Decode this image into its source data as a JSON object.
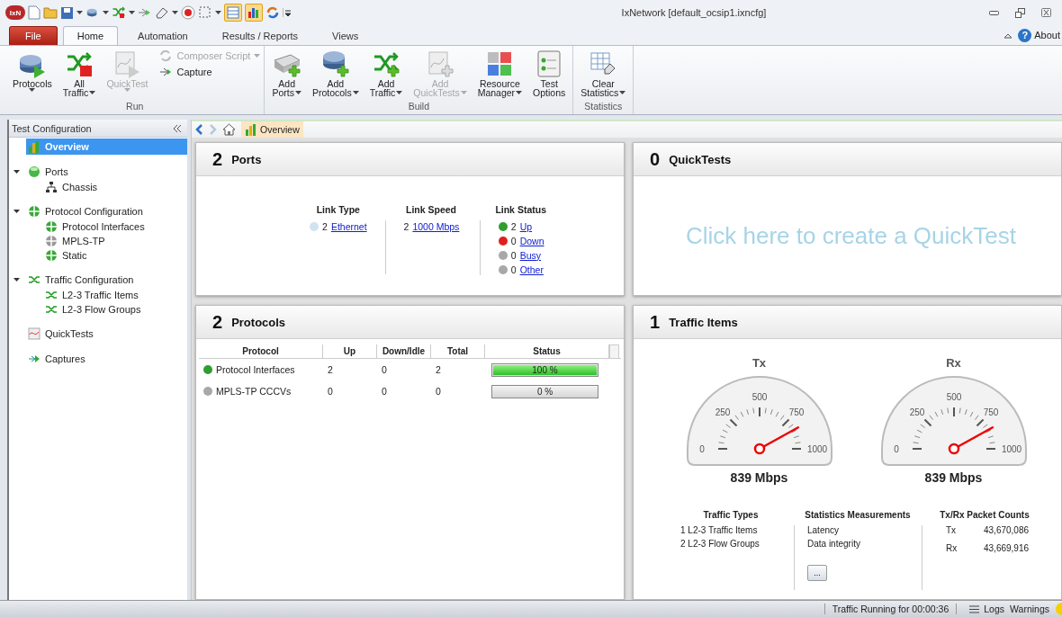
{
  "window": {
    "logo": "IxN",
    "title": "IxNetwork [default_ocsip1.ixncfg]"
  },
  "quick_access_toggles": [
    {
      "selected": true
    },
    {
      "selected": true
    }
  ],
  "file_menu": {
    "label": "File"
  },
  "ribbon_tabs": [
    {
      "label": "Home",
      "selected": true
    },
    {
      "label": "Automation",
      "selected": false
    },
    {
      "label": "Results / Reports",
      "selected": false
    },
    {
      "label": "Views",
      "selected": false
    }
  ],
  "help": {
    "symbol": "?",
    "label": "About"
  },
  "ribbon_groups": [
    {
      "title": "Run",
      "large": [
        {
          "lines": [
            "Protocols"
          ],
          "dropdown": true,
          "disabled": false
        },
        {
          "lines": [
            "All",
            "Traffic"
          ],
          "dropdown": true,
          "disabled": false
        },
        {
          "lines": [
            "QuickTest"
          ],
          "dropdown": true,
          "disabled": true
        }
      ],
      "small": [
        {
          "label": "Composer Script",
          "dropdown": true,
          "disabled": true
        },
        {
          "label": "Capture",
          "dropdown": false,
          "disabled": false
        }
      ]
    },
    {
      "title": "Build",
      "large": [
        {
          "lines": [
            "Add",
            "Ports"
          ],
          "dropdown": true,
          "disabled": false
        },
        {
          "lines": [
            "Add",
            "Protocols"
          ],
          "dropdown": true,
          "disabled": false
        },
        {
          "lines": [
            "Add",
            "Traffic"
          ],
          "dropdown": true,
          "disabled": false
        },
        {
          "lines": [
            "Add",
            "QuickTests"
          ],
          "dropdown": true,
          "disabled": true
        },
        {
          "lines": [
            "Resource",
            "Manager"
          ],
          "dropdown": true,
          "disabled": false
        },
        {
          "lines": [
            "Test",
            "Options"
          ],
          "dropdown": false,
          "disabled": false
        }
      ]
    },
    {
      "title": "Statistics",
      "large": [
        {
          "lines": [
            "Clear",
            "Statistics"
          ],
          "dropdown": true,
          "disabled": false
        }
      ]
    }
  ],
  "sidebar": {
    "title": "Test Configuration",
    "items": [
      {
        "label": "Overview",
        "selected": true
      },
      {
        "label": "Ports",
        "selected": false,
        "expanded": true,
        "children": [
          {
            "label": "Chassis",
            "selected": false
          }
        ]
      },
      {
        "label": "Protocol Configuration",
        "selected": false,
        "expanded": true,
        "children": [
          {
            "label": "Protocol Interfaces",
            "selected": false
          },
          {
            "label": "MPLS-TP",
            "selected": false
          },
          {
            "label": "Static",
            "selected": false
          }
        ]
      },
      {
        "label": "Traffic Configuration",
        "selected": false,
        "expanded": true,
        "children": [
          {
            "label": "L2-3 Traffic Items",
            "selected": false
          },
          {
            "label": "L2-3 Flow Groups",
            "selected": false
          }
        ]
      },
      {
        "label": "QuickTests",
        "selected": false
      },
      {
        "label": "Captures",
        "selected": false
      }
    ]
  },
  "breadcrumb": {
    "label": "Overview"
  },
  "ports": {
    "count": "2",
    "title": "Ports",
    "columns": [
      {
        "heading": "Link Type",
        "entries": [
          {
            "count": "2",
            "link": "Ethernet",
            "color": "#cfe4f0"
          }
        ]
      },
      {
        "heading": "Link Speed",
        "entries": [
          {
            "count": "2",
            "link": "1000 Mbps"
          }
        ]
      },
      {
        "heading": "Link Status",
        "entries": [
          {
            "count": "2",
            "link": "Up",
            "color": "#2f9e2f"
          },
          {
            "count": "0",
            "link": "Down",
            "color": "#e02020"
          },
          {
            "count": "0",
            "link": "Busy",
            "color": "#a8a8a8"
          },
          {
            "count": "0",
            "link": "Other",
            "color": "#a8a8a8"
          }
        ]
      }
    ]
  },
  "quicktests": {
    "count": "0",
    "title": "QuickTests",
    "prompt": "Click here to create a QuickTest"
  },
  "protocols": {
    "count": "2",
    "title": "Protocols",
    "columns": [
      "Protocol",
      "Up",
      "Down/Idle",
      "Total",
      "Status"
    ],
    "rows": [
      {
        "name": "Protocol Interfaces",
        "color": "#2f9e2f",
        "up": "2",
        "down": "0",
        "total": "2",
        "level": 1,
        "status": "100 %"
      },
      {
        "name": "MPLS-TP CCCVs",
        "color": "#a8a8a8",
        "up": "0",
        "down": "0",
        "total": "0",
        "level": 0,
        "status": "0 %"
      }
    ]
  },
  "traffic": {
    "count": "1",
    "title": "Traffic Items",
    "gauges": [
      {
        "label": "Tx",
        "ticks": [
          "0",
          "250",
          "500",
          "750",
          "1000"
        ],
        "reading": "839 Mbps"
      },
      {
        "label": "Rx",
        "ticks": [
          "0",
          "250",
          "500",
          "750",
          "1000"
        ],
        "reading": "839 Mbps"
      }
    ],
    "summary": [
      {
        "kind": "list",
        "heading": "Traffic Types",
        "lines": [
          "1 L2-3 Traffic Items",
          "2 L2-3 Flow Groups"
        ]
      },
      {
        "kind": "list",
        "heading": "Statistics Measurements",
        "lines": [
          "Latency",
          "Data integrity"
        ],
        "button": "..."
      },
      {
        "kind": "counts",
        "heading": "Tx/Rx Packet Counts",
        "pairs": [
          {
            "name": "Tx",
            "value": "43,670,086"
          },
          {
            "name": "Rx",
            "value": "43,669,916"
          }
        ]
      }
    ]
  },
  "status_bar": {
    "message": "Traffic Running for 00:00:36",
    "logs": "Logs",
    "warnings": "Warnings"
  }
}
